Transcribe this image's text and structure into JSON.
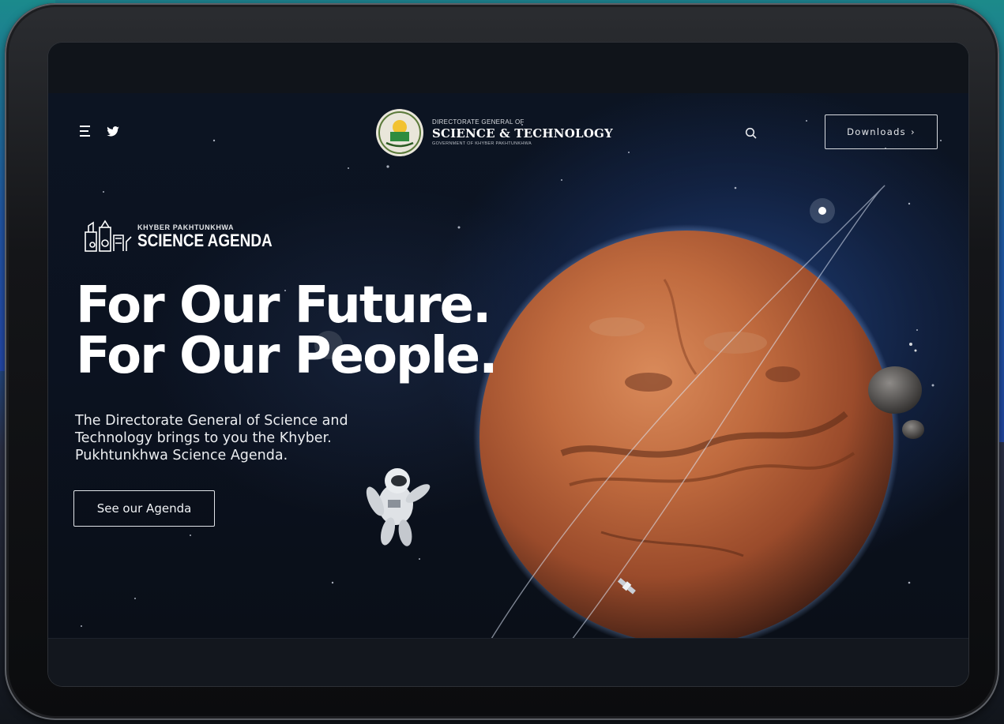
{
  "header": {
    "brand": {
      "line1": "DIRECTORATE GENERAL OF",
      "line2": "SCIENCE & TECHNOLOGY",
      "line3": "GOVERNMENT OF KHYBER PAKHTUNKHWA"
    },
    "downloads_label": "Downloads",
    "icons": [
      "menu-icon",
      "twitter-icon",
      "search-icon",
      "chevron-right-icon"
    ]
  },
  "agenda_logo": {
    "small": "KHYBER PAKHTUNKHWA",
    "big": "SCIENCE AGENDA"
  },
  "hero": {
    "headline_line1": "For Our Future.",
    "headline_line2": "For Our People.",
    "subtext_line1": "The Directorate General of Science and",
    "subtext_line2": "Technology brings to you the Khyber.",
    "subtext_line3": "Pukhtunkhwa Science Agenda.",
    "cta_label": "See our Agenda"
  },
  "colors": {
    "background": "#0b1220",
    "planet": "#b9633a",
    "accent_text": "#ffffff"
  }
}
